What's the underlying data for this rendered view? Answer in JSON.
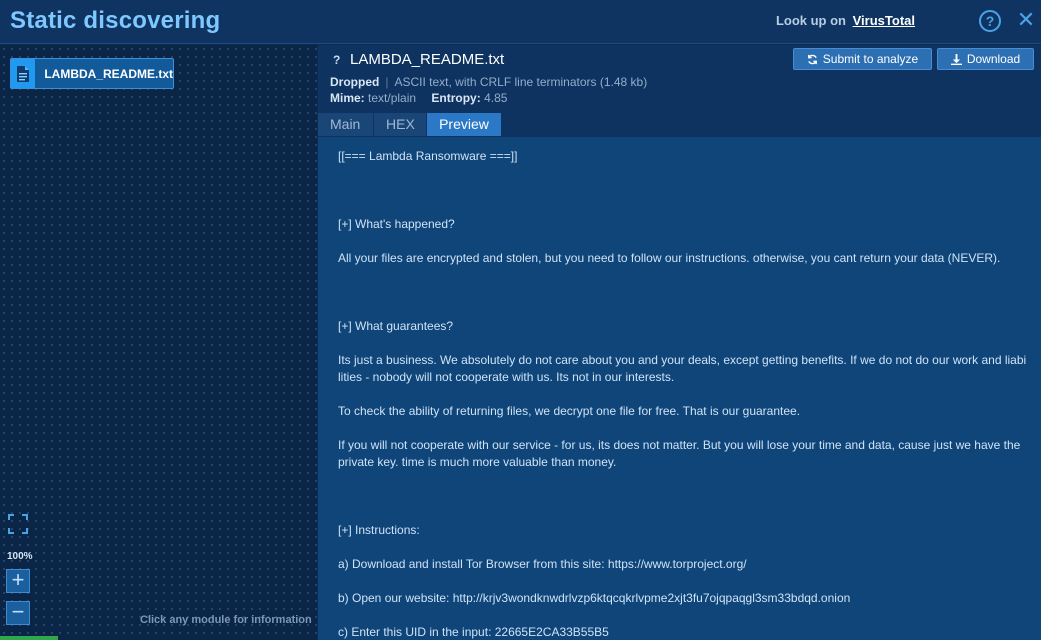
{
  "header": {
    "title": "Static discovering",
    "lookup_text": "Look up on",
    "lookup_link": "VirusTotal",
    "help_glyph": "?",
    "close_glyph": "✕"
  },
  "left": {
    "module_label": "LAMBDA_README.txt",
    "zoom_level": "100%",
    "zoom_in_glyph": "+",
    "zoom_out_glyph": "−",
    "hint": "Click any module for information"
  },
  "file": {
    "unknown_mark": "?",
    "name": "LAMBDA_README.txt",
    "dropped_label": "Dropped",
    "description": "ASCII text, with CRLF line terminators (1.48 kb)",
    "mime_label": "Mime:",
    "mime_value": "text/plain",
    "entropy_label": "Entropy:",
    "entropy_value": "4.85"
  },
  "actions": {
    "submit_label": "Submit to analyze",
    "download_label": "Download"
  },
  "tabs": [
    {
      "label": "Main"
    },
    {
      "label": "HEX"
    },
    {
      "label": "Preview"
    }
  ],
  "preview": {
    "line_01": "[[=== Lambda Ransomware ===]]",
    "line_02": "[+] What's happened?",
    "line_03": "All your files are encrypted and stolen, but you need to follow our instructions. otherwise, you cant return your data (NEVER).",
    "line_04": "[+] What guarantees?",
    "line_05": "Its just a business. We absolutely do not care about you and your deals, except getting benefits. If we do not do our work and liabi lities - nobody will not cooperate with us. Its not in our interests.",
    "line_06": "To check the ability of returning files, we decrypt one file for free. That is our guarantee.",
    "line_07": "If you will not cooperate with our service - for us, its does not matter. But you will lose your time and data, cause just we have the private key. time is much more valuable than money.",
    "line_08": "[+] Instructions:",
    "line_09": "a) Download and install Tor Browser from this site: https://www.torproject.org/",
    "line_10": "b) Open our website: http://krjv3wondknwdrlvzp6ktqcqkrlvpme2xjt3fu7ojqpaqgl3sm33bdqd.onion",
    "line_11": "c) Enter this UID in the input: 22665E2CA33B55B5"
  },
  "colors": {
    "accent": "#2a78c6",
    "title": "#7ec8ff",
    "panel": "#0f4579"
  }
}
